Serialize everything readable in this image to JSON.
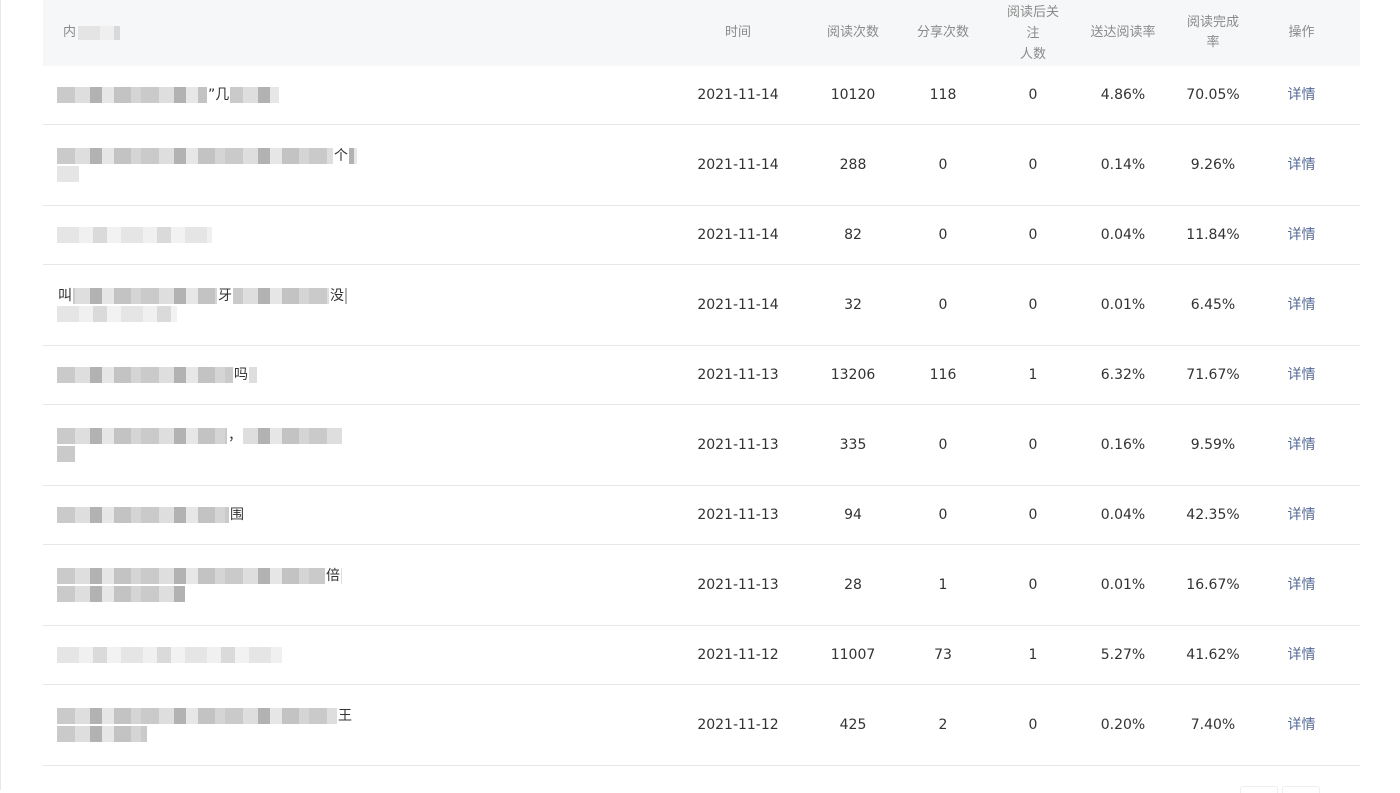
{
  "table": {
    "headers": {
      "content": "内",
      "time": "时间",
      "reads": "阅读次数",
      "shares": "分享次数",
      "follow_line1": "阅读后关注",
      "follow_line2": "人数",
      "delivery_rate": "送达阅读率",
      "completion_rate": "阅读完成率",
      "action": "操作"
    },
    "rows": [
      {
        "title_fragment": "”几",
        "date": "2021-11-14",
        "reads": "10120",
        "shares": "118",
        "follows": "0",
        "delivery_rate": "4.86%",
        "completion_rate": "70.05%",
        "action": "详情"
      },
      {
        "title_fragment": "个",
        "date": "2021-11-14",
        "reads": "288",
        "shares": "0",
        "follows": "0",
        "delivery_rate": "0.14%",
        "completion_rate": "9.26%",
        "action": "详情"
      },
      {
        "title_fragment": "",
        "date": "2021-11-14",
        "reads": "82",
        "shares": "0",
        "follows": "0",
        "delivery_rate": "0.04%",
        "completion_rate": "11.84%",
        "action": "详情"
      },
      {
        "title_fragment": "牙",
        "title_fragment_end": "没",
        "title_fragment_start": "叫",
        "date": "2021-11-14",
        "reads": "32",
        "shares": "0",
        "follows": "0",
        "delivery_rate": "0.01%",
        "completion_rate": "6.45%",
        "action": "详情"
      },
      {
        "title_fragment": "吗",
        "date": "2021-11-13",
        "reads": "13206",
        "shares": "116",
        "follows": "1",
        "delivery_rate": "6.32%",
        "completion_rate": "71.67%",
        "action": "详情"
      },
      {
        "title_fragment": "，",
        "date": "2021-11-13",
        "reads": "335",
        "shares": "0",
        "follows": "0",
        "delivery_rate": "0.16%",
        "completion_rate": "9.59%",
        "action": "详情"
      },
      {
        "title_fragment": "围",
        "date": "2021-11-13",
        "reads": "94",
        "shares": "0",
        "follows": "0",
        "delivery_rate": "0.04%",
        "completion_rate": "42.35%",
        "action": "详情"
      },
      {
        "title_fragment": "倍",
        "date": "2021-11-13",
        "reads": "28",
        "shares": "1",
        "follows": "0",
        "delivery_rate": "0.01%",
        "completion_rate": "16.67%",
        "action": "详情"
      },
      {
        "title_fragment": "",
        "date": "2021-11-12",
        "reads": "11007",
        "shares": "73",
        "follows": "1",
        "delivery_rate": "5.27%",
        "completion_rate": "41.62%",
        "action": "详情"
      },
      {
        "title_fragment": "王",
        "date": "2021-11-12",
        "reads": "425",
        "shares": "2",
        "follows": "0",
        "delivery_rate": "0.20%",
        "completion_rate": "7.40%",
        "action": "详情"
      }
    ]
  }
}
